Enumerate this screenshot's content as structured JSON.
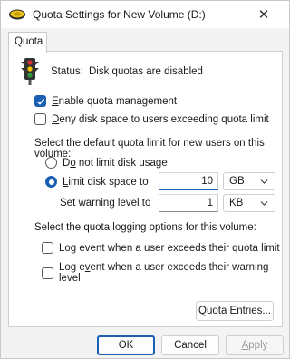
{
  "window": {
    "title": "Quota Settings for New Volume (D:)",
    "close_glyph": "✕"
  },
  "tabs": [
    {
      "label": "Quota"
    }
  ],
  "status": {
    "label": "Status:",
    "value": "Disk quotas are disabled"
  },
  "options": {
    "enable_quota": {
      "prefix": "",
      "mnemonic": "E",
      "rest": "nable quota management",
      "checked": true
    },
    "deny_space": {
      "prefix": "",
      "mnemonic": "D",
      "rest": "eny disk space to users exceeding quota limit",
      "checked": false
    }
  },
  "default_limit": {
    "heading": "Select the default quota limit for new users on this volume:",
    "no_limit": {
      "prefix": "D",
      "mnemonic": "o",
      "rest": " not limit disk usage",
      "selected": false
    },
    "limit": {
      "prefix": "",
      "mnemonic": "L",
      "rest": "imit disk space to",
      "selected": true,
      "value": "10",
      "unit": "GB"
    },
    "warning": {
      "label": "Set warning level to",
      "value": "1",
      "unit": "KB"
    }
  },
  "logging": {
    "heading": "Select the quota logging options for this volume:",
    "log_quota": {
      "prefix": "Lo",
      "mnemonic": "g",
      "rest": " event when a user exceeds their quota limit",
      "checked": false
    },
    "log_warning": {
      "prefix": "Log e",
      "mnemonic": "v",
      "rest": "ent when a user exceeds their warning level",
      "checked": false
    }
  },
  "buttons": {
    "quota_entries": {
      "mnemonic": "Q",
      "rest": "uota Entries..."
    },
    "ok": "OK",
    "cancel": "Cancel",
    "apply": {
      "mnemonic": "A",
      "rest": "pply",
      "disabled": true
    }
  },
  "colors": {
    "accent": "#1a5fb4",
    "traffic_red": "#d32f2f",
    "traffic_yellow": "#f2c200",
    "traffic_green": "#2e9a3c"
  },
  "icons": {
    "title": "drive-icon",
    "status": "traffic-light-icon",
    "dropdown": "chevron-down-icon"
  }
}
